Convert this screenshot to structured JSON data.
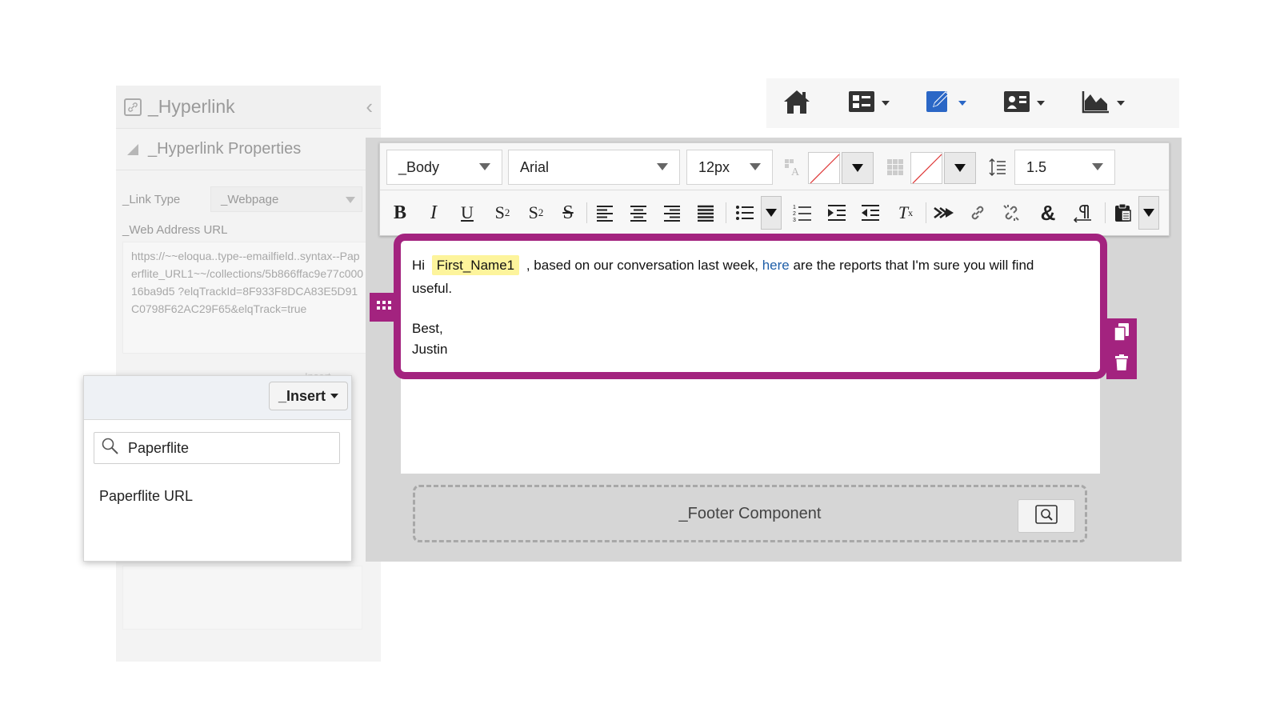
{
  "hyperlink_panel": {
    "title": "_Hyperlink",
    "section_title": "_Hyperlink Properties",
    "link_type_label": "_Link Type",
    "link_type_value": "_Webpage",
    "web_address_label": "_Web Address URL",
    "url_value": "https://~~eloqua..type--emailfield..syntax--Paperflite_URL1~~/collections/5b866ffac9e77c00016ba9d5 ?elqTrackId=8F933F8DCA83E5D91C0798F62AC29F65&elqTrack=true",
    "faint_insert_label": "Insert"
  },
  "insert_popup": {
    "button_label": "_Insert",
    "search_value": "Paperflite",
    "results": [
      "Paperflite URL"
    ]
  },
  "topnav": {
    "items": [
      {
        "icon": "home-icon"
      },
      {
        "icon": "components-icon"
      },
      {
        "icon": "edit-pencil-icon",
        "active_color": "#2b67c6"
      },
      {
        "icon": "contact-card-icon"
      },
      {
        "icon": "chart-icon"
      }
    ]
  },
  "toolbar": {
    "style_value": "_Body",
    "font_value": "Arial",
    "size_value": "12px",
    "line_height_value": "1.5"
  },
  "email": {
    "greeting": "Hi",
    "merge_field": "First_Name1",
    "text_before_link": ", based on our conversation last week,",
    "link_text": "here",
    "text_after_link": "are the reports that I'm sure you will find useful.",
    "signoff": "Best,",
    "signature": "Justin",
    "accent_color": "#a3237f",
    "merge_highlight": "#fdf49c"
  },
  "footer": {
    "label": "_Footer Component"
  }
}
